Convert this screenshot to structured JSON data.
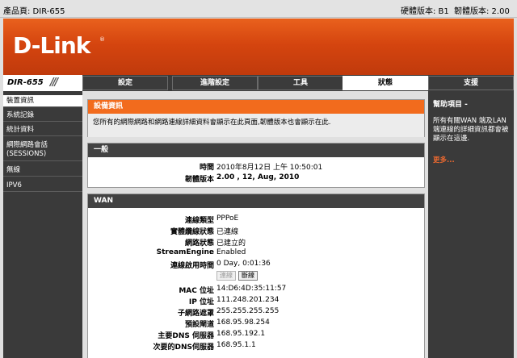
{
  "topbar": {
    "product": "產品頁: DIR-655",
    "hw_version": "硬體版本: B1",
    "fw_version": "韌體版本: 2.00"
  },
  "brand": {
    "logo": "D-Link",
    "reg": "®"
  },
  "model_label": "DIR-655",
  "tabs": [
    {
      "label": "設定",
      "active": false
    },
    {
      "label": "進階設定",
      "active": false
    },
    {
      "label": "工具",
      "active": false
    },
    {
      "label": "狀態",
      "active": true
    },
    {
      "label": "支援",
      "active": false
    }
  ],
  "sidebar": [
    {
      "label": "裝置資訊",
      "active": true
    },
    {
      "label": "系統記錄",
      "active": false
    },
    {
      "label": "統計資料",
      "active": false
    },
    {
      "label": "網際網路會話\n(SESSIONS)",
      "active": false
    },
    {
      "label": "無線",
      "active": false
    },
    {
      "label": "IPV6",
      "active": false
    }
  ],
  "device_info": {
    "title": "設備資訊",
    "description": "您所有的網際網路和網路連線詳細資料會顯示在此頁面,韌體版本也會顯示在此."
  },
  "general": {
    "title": "一般",
    "time_label": "時間",
    "time_value": "2010年8月12日 上午 10:50:01",
    "fw_label": "韌體版本",
    "fw_value": "2.00 , 12, Aug, 2010"
  },
  "wan": {
    "title": "WAN",
    "conn_type_label": "連線類型",
    "conn_type_value": "PPPoE",
    "cable_label": "實體纜線狀態",
    "cable_value": "已連線",
    "net_label": "網路狀態",
    "net_value": "已建立的",
    "stream_label": "StreamEngine",
    "stream_value": "Enabled",
    "uptime_label": "連線啟用時間",
    "uptime_value": "0 Day, 0:01:36",
    "connect_btn": "連線",
    "disconnect_btn": "斷線",
    "mac_label": "MAC 位址",
    "mac_value": "14:D6:4D:35:11:57",
    "ip_label": "IP 位址",
    "ip_value": "111.248.201.234",
    "mask_label": "子網路遮罩",
    "mask_value": "255.255.255.255",
    "gw_label": "預設閘道",
    "gw_value": "168.95.98.254",
    "dns1_label": "主要DNS 伺服器",
    "dns1_value": "168.95.192.1",
    "dns2_label": "次要的DNS伺服器",
    "dns2_value": "168.95.1.1"
  },
  "help": {
    "title": "幫助項目 -",
    "body": "所有有關WAN 端及LAN 端連線的詳細資訊都會被顯示在這邊.",
    "more": "更多..."
  },
  "colors": {
    "accent": "#f26b1d",
    "dark": "#3a3a3a"
  }
}
